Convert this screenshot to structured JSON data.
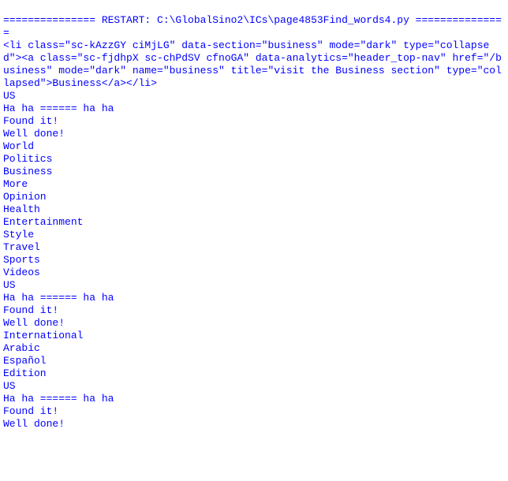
{
  "restart_line": "=============== RESTART: C:\\GlobalSino2\\ICs\\page4853Find_words4.py ===============",
  "html_dump": "<li class=\"sc-kAzzGY ciMjLG\" data-section=\"business\" mode=\"dark\" type=\"collapsed\"><a class=\"sc-fjdhpX sc-chPdSV cfnoGA\" data-analytics=\"header_top-nav\" href=\"/business\" mode=\"dark\" name=\"business\" title=\"visit the Business section\" type=\"collapsed\">Business</a></li>",
  "blank": "",
  "block1": [
    "US",
    "Ha ha ====== ha ha",
    "Found it!",
    "Well done!"
  ],
  "block2": [
    "World",
    "Politics",
    "Business",
    "More",
    "Opinion",
    "Health",
    "Entertainment",
    "Style",
    "Travel",
    "Sports",
    "Videos",
    "US",
    "Ha ha ====== ha ha",
    "Found it!",
    "Well done!"
  ],
  "block3": [
    "International",
    "Arabic",
    "Español",
    "Edition",
    "US",
    "Ha ha ====== ha ha",
    "Found it!",
    "Well done!"
  ]
}
